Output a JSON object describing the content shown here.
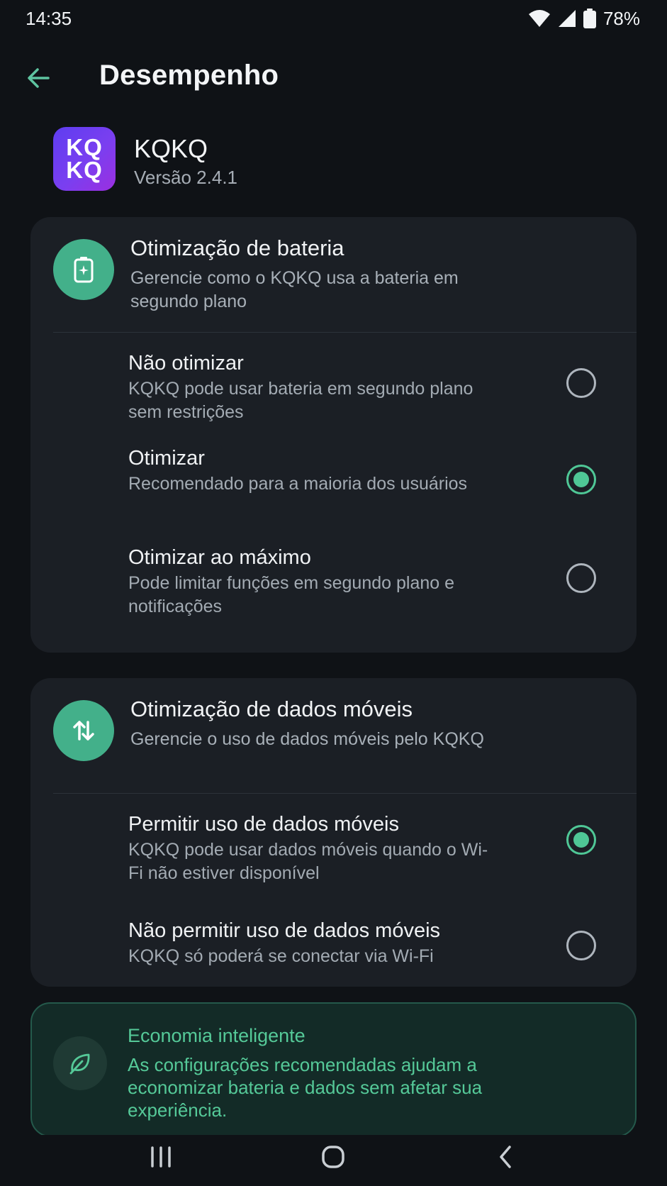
{
  "status_bar": {
    "time": "14:35",
    "battery_percent": "78%",
    "icons": [
      "wifi-icon",
      "signal-icon",
      "battery-icon"
    ]
  },
  "app_bar": {
    "back_icon": "arrow-left-icon",
    "title": "Desempenho"
  },
  "app_info": {
    "icon_text_line1": "KQ",
    "icon_text_line2": "KQ",
    "name": "KQKQ",
    "version": "Versão 2.4.1"
  },
  "battery_section": {
    "icon": "battery-charging-icon",
    "title": "Otimização de bateria",
    "description": "Gerencie como o KQKQ usa a bateria em segundo plano",
    "options": [
      {
        "title": "Não otimizar",
        "description": "KQKQ pode usar bateria em segundo plano sem restrições",
        "selected": false
      },
      {
        "title": "Otimizar",
        "description": "Recomendado para a maioria dos usuários",
        "selected": true
      },
      {
        "title": "Otimizar ao máximo",
        "description": "Pode limitar funções em segundo plano e notificações",
        "selected": false
      }
    ]
  },
  "data_section": {
    "icon": "swap-vertical-icon",
    "title": "Otimização de dados móveis",
    "description": "Gerencie o uso de dados móveis pelo KQKQ",
    "options": [
      {
        "title": "Permitir uso de dados móveis",
        "description": "KQKQ pode usar dados móveis quando o Wi-Fi não estiver disponível",
        "selected": true
      },
      {
        "title": "Não permitir uso de dados móveis",
        "description": "KQKQ só poderá se conectar via Wi-Fi",
        "selected": false
      }
    ]
  },
  "info_card": {
    "icon": "leaf-icon",
    "title": "Economia inteligente",
    "text": "As configurações recomendadas ajudam a economizar bateria e dados sem afetar sua experiência."
  },
  "nav_bar": {
    "icons": [
      "recents-icon",
      "home-icon",
      "back-icon"
    ]
  },
  "colors": {
    "background": "#0f1216",
    "card": "#1b1f25",
    "accent": "#4fc796",
    "icon_circle": "#43b08a"
  }
}
